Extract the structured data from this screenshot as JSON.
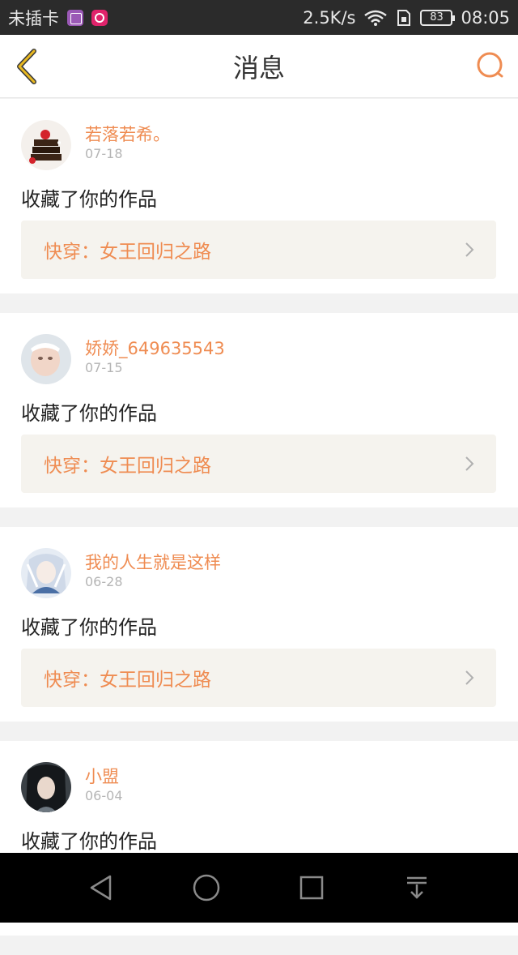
{
  "status_bar": {
    "carrier": "未插卡",
    "speed": "2.5K/s",
    "battery": "83",
    "time": "08:05"
  },
  "header": {
    "title": "消息"
  },
  "messages": [
    {
      "username": "若落若希。",
      "date": "07-18",
      "action": "收藏了你的作品",
      "work": "快穿：女王回归之路"
    },
    {
      "username": "娇娇_649635543",
      "date": "07-15",
      "action": "收藏了你的作品",
      "work": "快穿：女王回归之路"
    },
    {
      "username": "我的人生就是这样",
      "date": "06-28",
      "action": "收藏了你的作品",
      "work": "快穿：女王回归之路"
    },
    {
      "username": "小盟",
      "date": "06-04",
      "action": "收藏了你的作品"
    }
  ],
  "colors": {
    "accent": "#ef8c52",
    "back_icon": "#e8b820"
  },
  "icons": {
    "back": "chevron-left-icon",
    "search": "search-icon",
    "link_arrow": "chevron-right-icon",
    "nav_back": "triangle-back-icon",
    "nav_home": "circle-home-icon",
    "nav_recent": "square-recent-icon",
    "nav_notification": "pull-down-icon"
  }
}
